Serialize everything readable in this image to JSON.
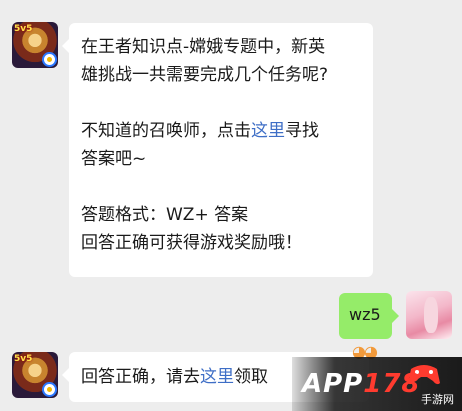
{
  "conversation": {
    "message1": {
      "lines": [
        "在王者知识点-嫦娥专题中，新英",
        "雄挑战一共需要完成几个任务呢?"
      ],
      "prompt_prefix": "不知道的召唤师，点击",
      "prompt_link": "这里",
      "prompt_suffix": "寻找",
      "prompt_line2": "答案吧~",
      "format_label": "答题格式：WZ+ 答案",
      "reward_line": "回答正确可获得游戏奖励哦！"
    },
    "reply": {
      "text": "wz5"
    },
    "message2": {
      "prefix": "回答正确，请去",
      "link": "这里",
      "suffix": "领取"
    }
  },
  "avatars": {
    "game_badge": "5v5",
    "game_icon": "king-glory-hero-avatar",
    "user_icon": "user-profile-photo"
  },
  "watermark": {
    "brand_prefix": "APP",
    "brand_num": "178",
    "site": "手游网"
  },
  "colors": {
    "background": "#ededed",
    "incoming_bubble": "#ffffff",
    "outgoing_bubble": "#95ec69",
    "link": "#3e6ec6"
  }
}
